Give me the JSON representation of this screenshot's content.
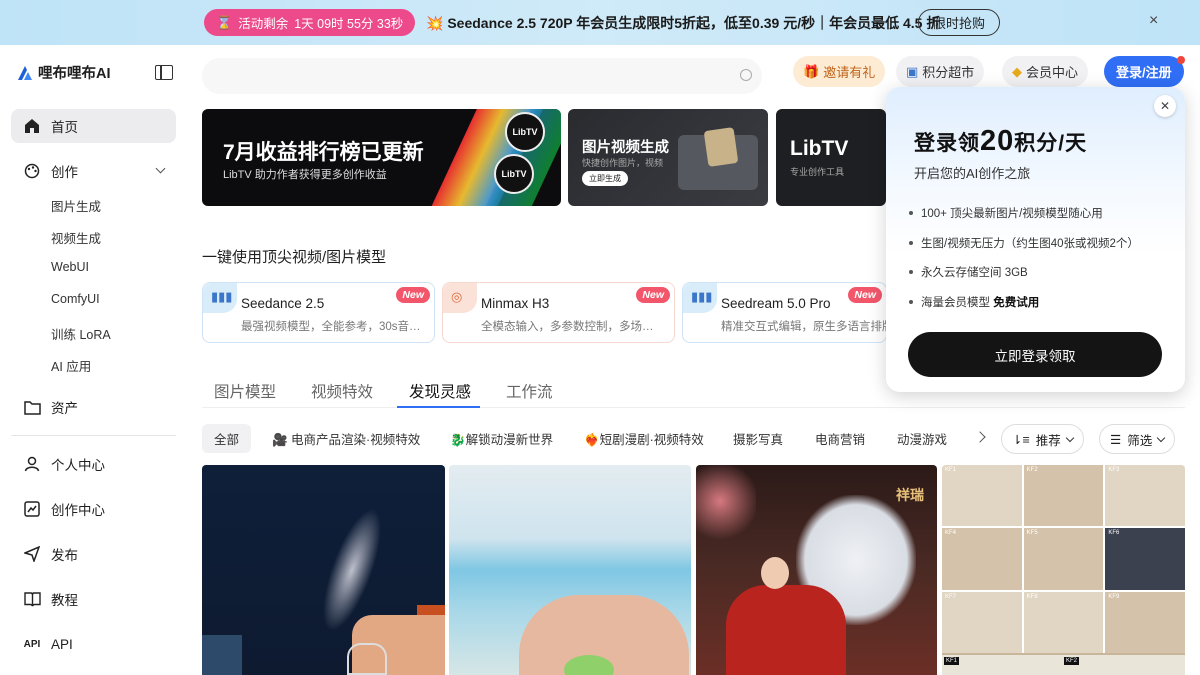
{
  "promo": {
    "countdown_label": "活动剩余",
    "countdown_value": "1天  09时 55分 33秒",
    "text": "💥 Seedance 2.5 720P 年会员生成限时5折起，低至0.39 元/秒｜年会员最低 4.5 折",
    "button": "限时抢购",
    "close": "×"
  },
  "brand": {
    "name": "哩布哩布AI"
  },
  "sidebar": {
    "items": [
      {
        "label": "首页",
        "icon": "home-icon"
      },
      {
        "label": "创作",
        "icon": "palette-icon"
      },
      {
        "label": "资产",
        "icon": "folder-icon"
      },
      {
        "label": "个人中心",
        "icon": "user-icon"
      },
      {
        "label": "创作中心",
        "icon": "chart-icon"
      },
      {
        "label": "发布",
        "icon": "send-icon"
      },
      {
        "label": "教程",
        "icon": "book-icon"
      },
      {
        "label": "API",
        "icon": "api-icon"
      }
    ],
    "sub_items": [
      "图片生成",
      "视频生成",
      "WebUI",
      "ComfyUI",
      "训练 LoRA",
      "AI 应用"
    ],
    "api_icon_text": "API"
  },
  "header": {
    "invite": "邀请有礼",
    "points_market": "积分超市",
    "vip_center": "会员中心",
    "login": "登录/注册"
  },
  "hero": {
    "card1_title": "7月收益排行榜已更新",
    "card1_sub": "LibTV 助力作者获得更多创作收益",
    "card1_badge": "LibTV",
    "card2_title": "图片视频生成",
    "card2_sub": "快捷创作图片，视频",
    "card2_button": "立即生成",
    "card3_title": "LibTV",
    "card3_sub": "专业创作工具"
  },
  "models": {
    "section_title": "一键使用顶尖视频/图片模型",
    "new_badge": "New",
    "cards": [
      {
        "name": "Seedance 2.5",
        "desc": "最强视频模型，全能参考，30s音…"
      },
      {
        "name": "Minmax H3",
        "desc": "全模态输入，多参数控制，多场…"
      },
      {
        "name": "Seedream 5.0 Pro",
        "desc": "精准交互式编辑，原生多语言排版"
      }
    ]
  },
  "tabs": [
    "图片模型",
    "视频特效",
    "发现灵感",
    "工作流"
  ],
  "active_tab": "发现灵感",
  "filters": {
    "chips": [
      "全部",
      "🎥 电商产品渲染·视频特效",
      "🐉解锁动漫新世界",
      "❤️‍🔥短剧漫剧·视频特效",
      "摄影写真",
      "电商营销",
      "动漫游戏"
    ],
    "sort": "推荐",
    "filter": "筛选"
  },
  "gallery": {
    "tile3_sign": "祥瑞",
    "keyframes": [
      "KF1",
      "KF2",
      "KF3",
      "KF4",
      "KF5",
      "KF6",
      "KF7",
      "KF8",
      "KF9"
    ]
  },
  "popup": {
    "title_pre": "登录领",
    "title_num": "20",
    "title_post": "积分/天",
    "subtitle": "开启您的AI创作之旅",
    "benefits": [
      "100+ 顶尖最新图片/视频模型随心用",
      "生图/视频无压力（约生图40张或视频2个）",
      "永久云存储空间 3GB"
    ],
    "benefit4_pre": "海量会员模型 ",
    "benefit4_bold": "免费试用",
    "button": "立即登录领取",
    "close": "✕"
  },
  "colors": {
    "accent": "#2f6ef5",
    "countdown_bg": "#ec4a8a",
    "new_badge": "#f2566b",
    "invite_text": "#c0641a"
  }
}
